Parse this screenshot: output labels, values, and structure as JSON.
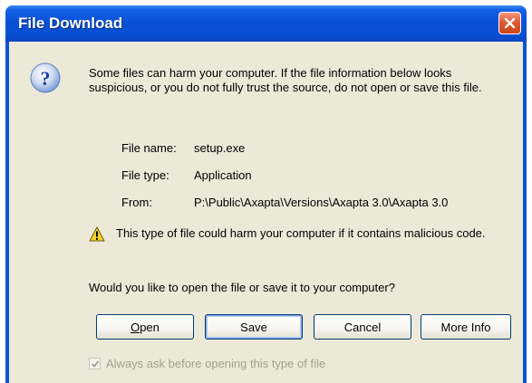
{
  "window": {
    "title": "File Download"
  },
  "message": "Some files can harm your computer. If the file information below looks suspicious, or you do not fully trust the source, do not open or save this file.",
  "file_info": [
    {
      "label": "File name:",
      "value": "setup.exe"
    },
    {
      "label": "File type:",
      "value": "Application"
    },
    {
      "label": "From:",
      "value": "P:\\Public\\Axapta\\Versions\\Axapta 3.0\\Axapta 3.0"
    }
  ],
  "warning": "This type of file could harm your computer if it contains malicious code.",
  "question": "Would you like to open the file or save it to your computer?",
  "buttons": {
    "open": {
      "first": "O",
      "rest": "pen"
    },
    "save": "Save",
    "cancel": "Cancel",
    "more_info": "More Info"
  },
  "always_ask": {
    "label": "Always ask before opening this type of file",
    "checked": true
  },
  "icons": {
    "question": "question-icon",
    "warning": "warning-icon",
    "close": "close-icon",
    "check": "check-icon"
  },
  "colors": {
    "titlebar": "#0a51d6",
    "dialog_bg": "#ece9d8",
    "close_button": "#e05a33"
  }
}
